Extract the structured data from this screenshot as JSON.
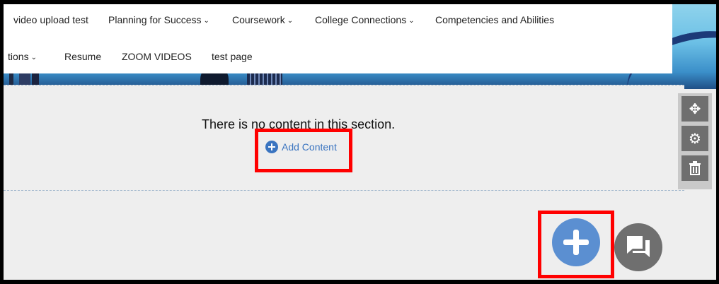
{
  "nav": {
    "row1": [
      {
        "label": "video upload test",
        "dropdown": false
      },
      {
        "label": "Planning for Success",
        "dropdown": true
      },
      {
        "label": "Coursework",
        "dropdown": true
      },
      {
        "label": "College Connections",
        "dropdown": true
      },
      {
        "label": "Competencies and Abilities",
        "dropdown": false
      }
    ],
    "row2": [
      {
        "label": "tions",
        "dropdown": true
      },
      {
        "label": "Resume",
        "dropdown": false
      },
      {
        "label": "ZOOM VIDEOS",
        "dropdown": false
      },
      {
        "label": "test page",
        "dropdown": false
      }
    ],
    "chevron": "⌄"
  },
  "section": {
    "empty_message": "There is no content in this section.",
    "add_content_label": "Add Content"
  },
  "tools": {
    "move_icon": "✥",
    "settings_icon": "⚙",
    "delete_icon": "🗑"
  },
  "colors": {
    "accent": "#3a74c0",
    "fab_add": "#5b8fd1",
    "highlight": "#ff0000",
    "tool_bg": "#6f6f6f"
  }
}
